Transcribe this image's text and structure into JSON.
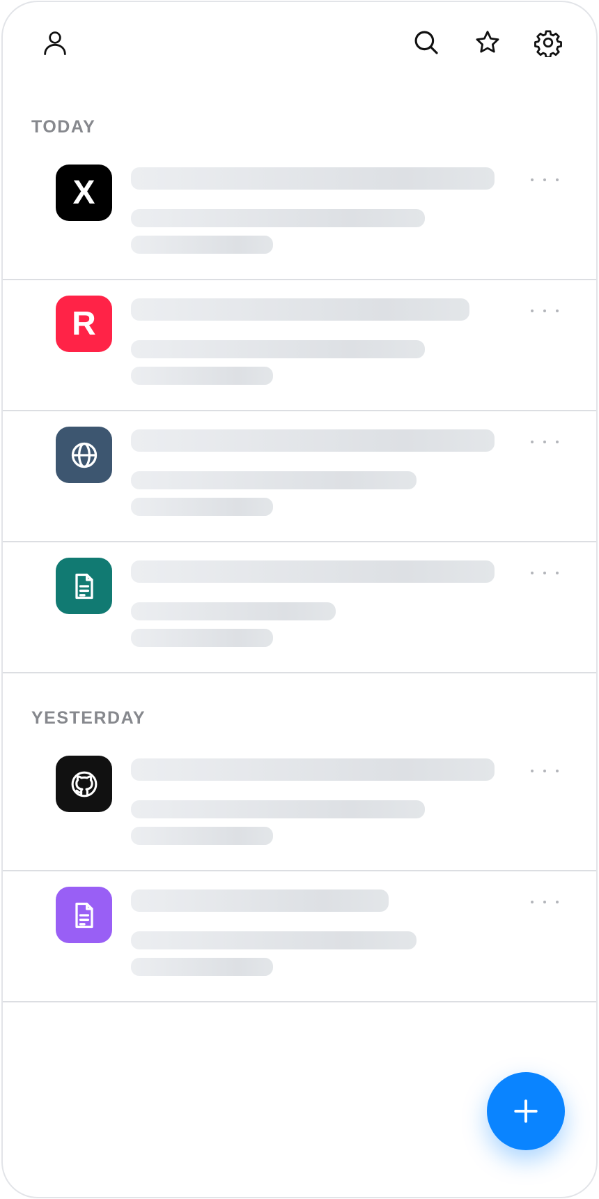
{
  "header": {
    "icons": [
      "person-icon",
      "search-icon",
      "star-icon",
      "gear-icon"
    ]
  },
  "sections": [
    {
      "label": "TODAY",
      "items": [
        {
          "icon": "x-logo-icon",
          "icon_text": "X",
          "icon_bg": "#000000"
        },
        {
          "icon": "r-logo-icon",
          "icon_text": "R",
          "icon_bg": "#ff2347"
        },
        {
          "icon": "globe-icon",
          "icon_text": "",
          "icon_bg": "#3d5670"
        },
        {
          "icon": "document-icon",
          "icon_text": "",
          "icon_bg": "#117a72"
        }
      ]
    },
    {
      "label": "YESTERDAY",
      "items": [
        {
          "icon": "github-icon",
          "icon_text": "",
          "icon_bg": "#111111"
        },
        {
          "icon": "document-icon",
          "icon_text": "",
          "icon_bg": "#995ff5"
        }
      ]
    }
  ],
  "fab": {
    "icon": "plus-icon",
    "color": "#0a84ff"
  },
  "colors": {
    "section_label": "#86888d",
    "skeleton": "#e3e6e9",
    "divider": "#dcdee2"
  }
}
